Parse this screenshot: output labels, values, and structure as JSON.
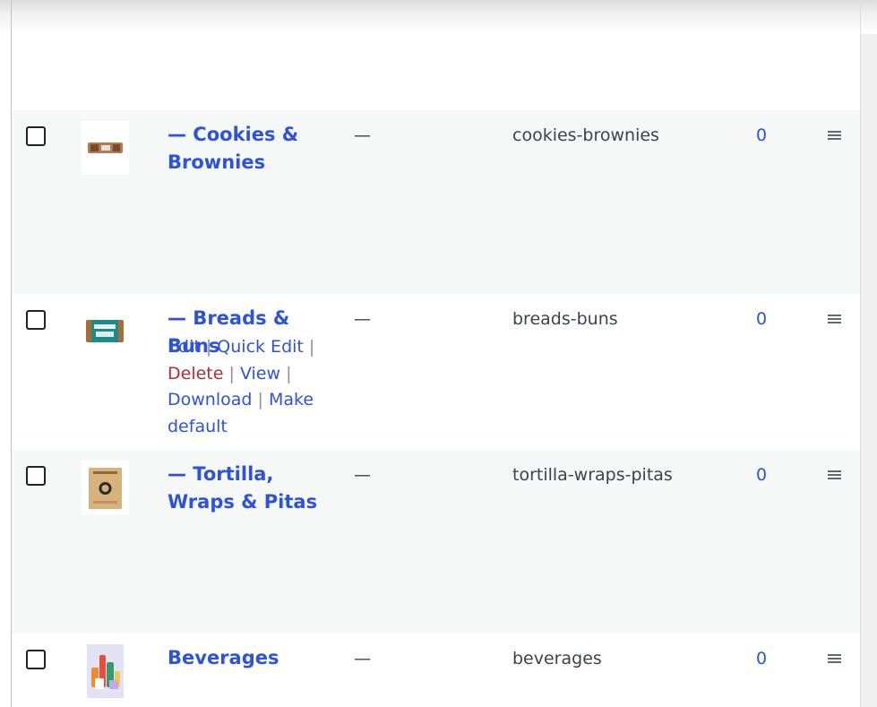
{
  "rows": [
    {
      "name": "— Cookies & Brownies",
      "description": "—",
      "slug": "cookies-brownies",
      "count": "0",
      "thumbnail": "cookies-brownies-package"
    },
    {
      "name": "— Breads & Buns",
      "description": "—",
      "slug": "breads-buns",
      "count": "0",
      "thumbnail": "bread-package",
      "row_actions": {
        "edit": "Edit",
        "quick_edit": "Quick Edit",
        "delete": "Delete",
        "view": "View",
        "download": "Download",
        "make": "Make",
        "default": "default",
        "separator": "|"
      }
    },
    {
      "name": "— Tortilla, Wraps & Pitas",
      "description": "—",
      "slug": "tortilla-wraps-pitas",
      "count": "0",
      "thumbnail": "tortilla-package"
    },
    {
      "name": "Beverages",
      "description": "—",
      "slug": "beverages",
      "count": "0",
      "thumbnail": "beverages-assortment"
    }
  ],
  "colors": {
    "link": "#2c53d9",
    "delete": "#b32d2e",
    "text": "#3c434a",
    "alt_row": "#f6f7f7"
  },
  "icons": {
    "drag_handle": "drag-handle-icon",
    "checkbox": "checkbox"
  }
}
